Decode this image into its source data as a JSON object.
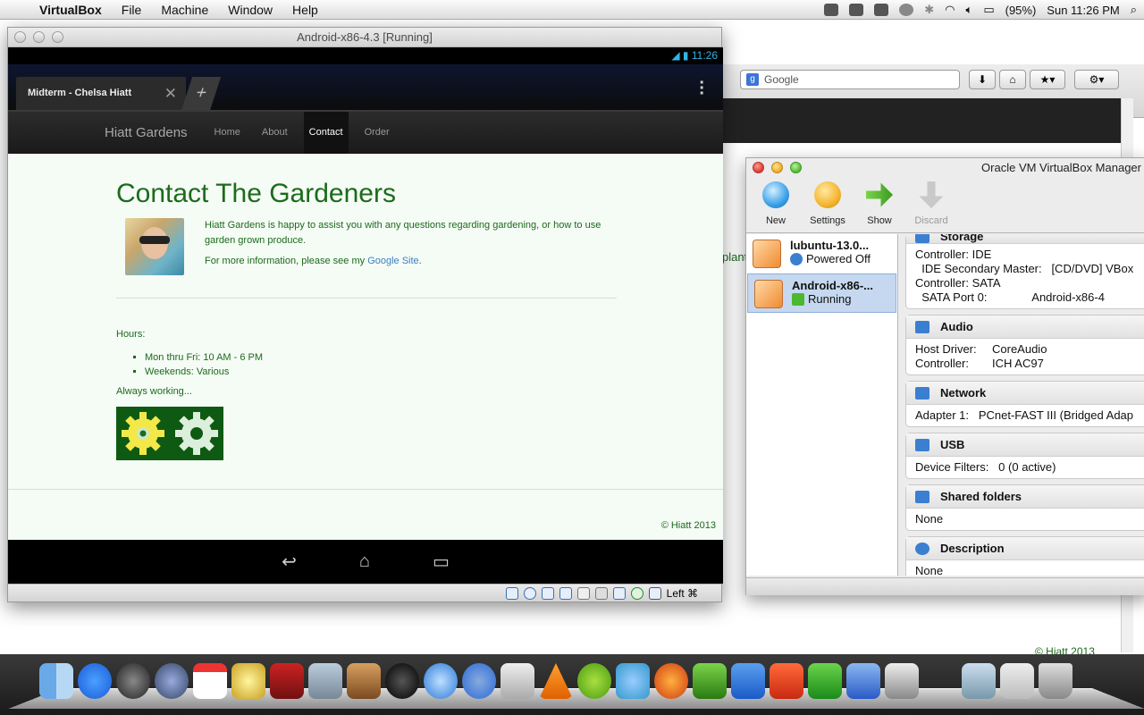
{
  "menubar": {
    "app": "VirtualBox",
    "items": [
      "File",
      "Machine",
      "Window",
      "Help"
    ],
    "battery": "(95%)",
    "clock": "Sun 11:26 PM"
  },
  "bg_browser": {
    "search_placeholder": "Google",
    "partial_text": "plant",
    "footer": "© Hiatt 2013"
  },
  "android_window": {
    "title": "Android-x86-4.3 [Running]",
    "status_time": "11:26",
    "tab_title": "Midterm - Chelsa Hiatt",
    "site": {
      "brand": "Hiatt Gardens",
      "nav": [
        "Home",
        "About",
        "Contact",
        "Order"
      ],
      "heading": "Contact The Gardeners",
      "intro": "Hiatt Gardens is happy to assist you with any questions regarding gardening, or how to use garden grown produce.",
      "more_info_prefix": "For more information, please see my ",
      "more_info_link": "Google Site",
      "more_info_suffix": ".",
      "hours_label": "Hours:",
      "hours": [
        "Mon thru Fri: 10 AM - 6 PM",
        "Weekends: Various"
      ],
      "always": "Always working...",
      "copyright": "© Hiatt 2013"
    },
    "status_right": "Left ⌘"
  },
  "vbox_manager": {
    "title": "Oracle VM VirtualBox Manager",
    "toolbar": [
      "New",
      "Settings",
      "Show",
      "Discard"
    ],
    "vms": [
      {
        "name": "lubuntu-13.0...",
        "state": "Powered Off"
      },
      {
        "name": "Android-x86-...",
        "state": "Running"
      }
    ],
    "details": {
      "storage": {
        "title": "Storage",
        "lines": [
          "Controller: IDE",
          "  IDE Secondary Master:   [CD/DVD] VBox",
          "Controller: SATA",
          "  SATA Port 0:              Android-x86-4"
        ]
      },
      "audio": {
        "title": "Audio",
        "host_key": "Host Driver:",
        "host_val": "CoreAudio",
        "ctrl_key": "Controller:",
        "ctrl_val": "ICH AC97"
      },
      "network": {
        "title": "Network",
        "line": "Adapter 1:   PCnet-FAST III (Bridged Adap"
      },
      "usb": {
        "title": "USB",
        "line": "Device Filters:   0 (0 active)"
      },
      "shared": {
        "title": "Shared folders",
        "line": "None"
      },
      "description": {
        "title": "Description",
        "line": "None"
      }
    }
  },
  "colors": {
    "site_green": "#1b6b1b",
    "link_blue": "#3b82c4",
    "android_blue": "#33b5e5"
  }
}
